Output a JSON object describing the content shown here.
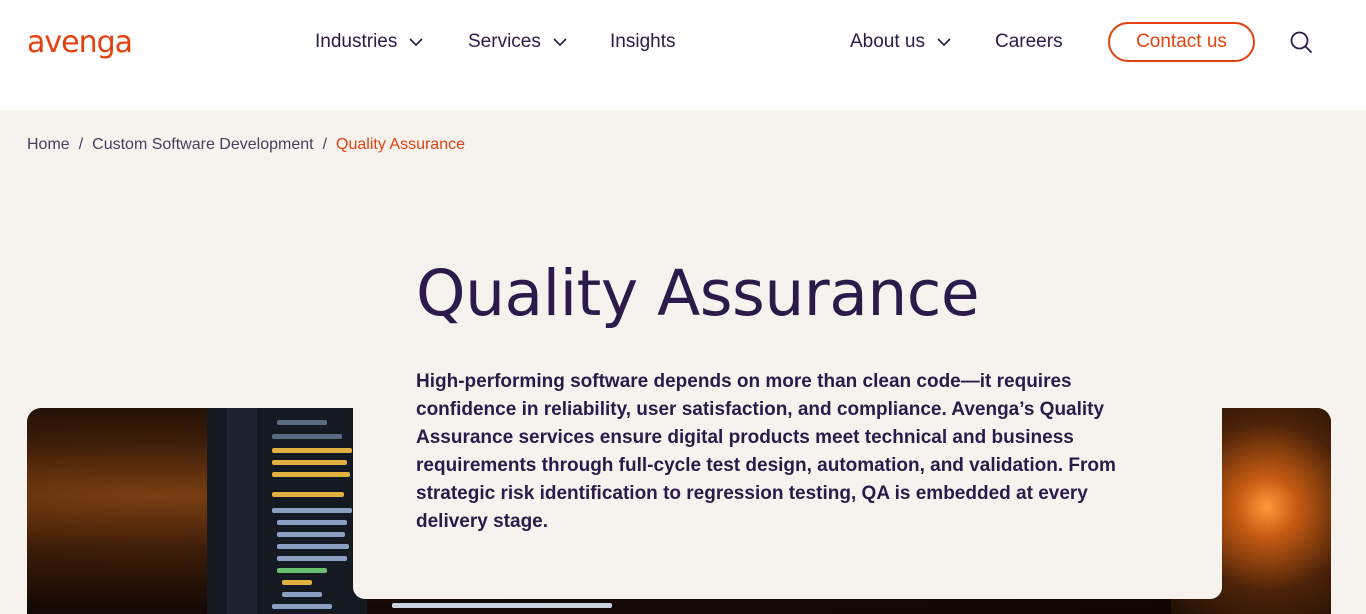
{
  "brand": {
    "logo_text": "avenga",
    "accent_color": "#e2420f",
    "text_color": "#2b1a4a"
  },
  "nav": {
    "industries": "Industries",
    "services": "Services",
    "insights": "Insights",
    "about": "About us",
    "careers": "Careers",
    "contact": "Contact us",
    "search_icon": "search-icon",
    "chevron_icon": "chevron-down-icon"
  },
  "breadcrumb": {
    "items": [
      "Home",
      "Custom Software Development",
      "Quality Assurance"
    ],
    "separator": "/"
  },
  "page": {
    "title": "Quality Assurance",
    "intro": "High-performing software depends on more than clean code—it requires confidence in reliability, user satisfaction, and compliance. Avenga’s Quality Assurance services ensure digital products meet technical and business requirements through full-cycle test design, automation, and validation. From strategic risk identification to regression testing, QA is embedded at every delivery stage."
  }
}
